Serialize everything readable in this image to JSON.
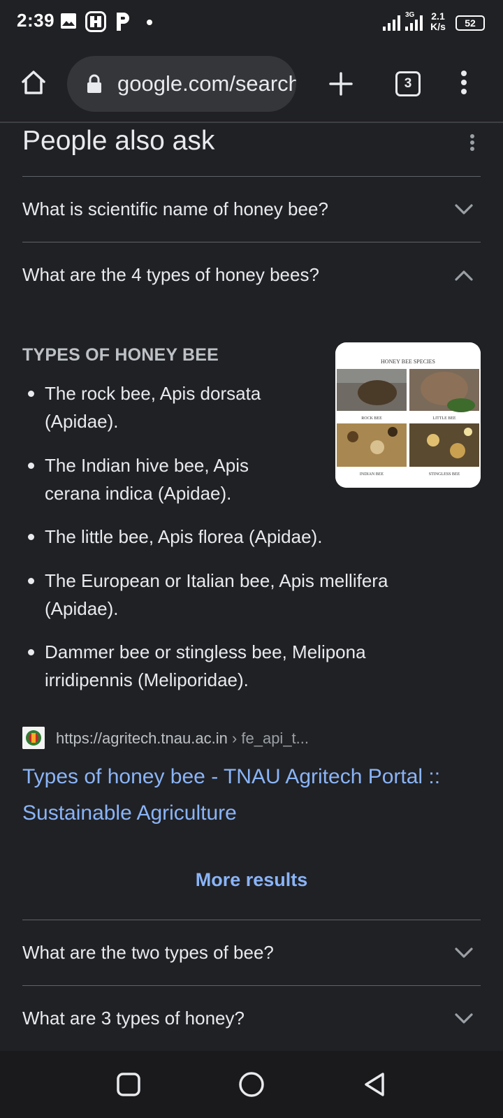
{
  "status_bar": {
    "time": "2:39",
    "left_icons": [
      "gallery-icon",
      "app-icon",
      "p-icon",
      "dot-icon"
    ],
    "network_label": "3G",
    "speed_value": "2.1",
    "speed_unit": "K/s",
    "battery": "52"
  },
  "toolbar": {
    "url": "google.com/search",
    "tabs_count": "3"
  },
  "paa": {
    "title": "People also ask",
    "questions": [
      {
        "text": "What is scientific name of honey bee?",
        "expanded": false
      },
      {
        "text": "What are the 4 types of honey bees?",
        "expanded": true
      },
      {
        "text": "What are the two types of bee?",
        "expanded": false
      },
      {
        "text": "What are 3 types of honey?",
        "expanded": false
      }
    ],
    "answer": {
      "heading": "TYPES OF HONEY BEE",
      "bullets": [
        {
          "line1": "The rock bee, Apis dorsata",
          "line2": "(Apidae)."
        },
        {
          "line1": "The Indian hive bee, Apis",
          "line2": "cerana indica (Apidae)."
        },
        {
          "line1": "The little bee, Apis florea (Apidae).",
          "line2": ""
        },
        {
          "line1": "The European or Italian bee, Apis mellifera",
          "line2": "(Apidae)."
        },
        {
          "line1": "Dammer bee or stingless bee, Melipona",
          "line2": "irridipennis (Meliporidae)."
        }
      ],
      "image": {
        "title": "HONEY BEE SPECIES",
        "captions": [
          "ROCK BEE",
          "LITTLE BEE",
          "INDIAN BEE",
          "STINGLESS BEE"
        ]
      },
      "source": {
        "domain": "https://agritech.tnau.ac.in",
        "breadcrumb": " › fe_api_t..."
      },
      "link_line1": "Types of honey bee - TNAU Agritech Portal ::",
      "link_line2": "Sustainable Agriculture"
    },
    "more_results": "More results"
  },
  "colors": {
    "background": "#202124",
    "link": "#8ab4f8",
    "text": "#e8eaed",
    "divider": "#5f6368"
  }
}
